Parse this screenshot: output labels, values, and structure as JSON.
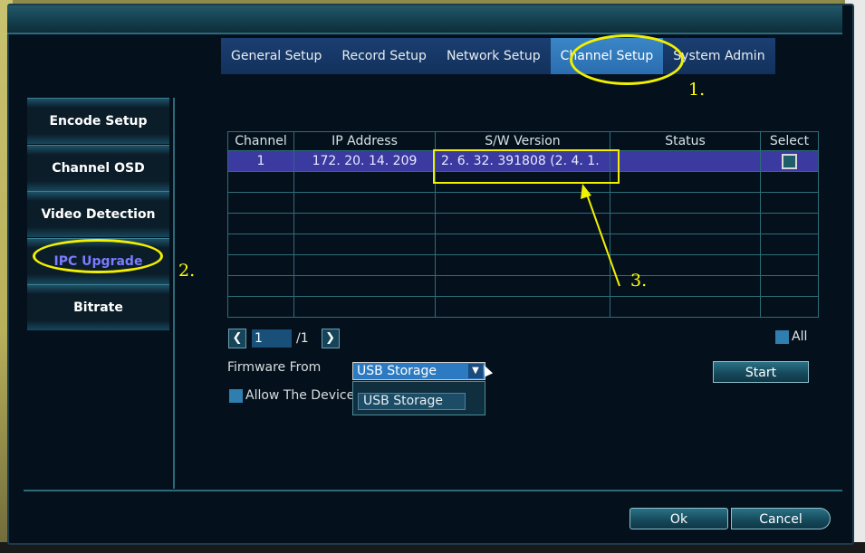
{
  "tabs": [
    {
      "label": "General Setup"
    },
    {
      "label": "Record Setup"
    },
    {
      "label": "Network Setup"
    },
    {
      "label": "Channel Setup",
      "active": true
    },
    {
      "label": "System Admin"
    }
  ],
  "sidebar": {
    "items": [
      {
        "label": "Encode Setup"
      },
      {
        "label": "Channel OSD"
      },
      {
        "label": "Video Detection"
      },
      {
        "label": "IPC Upgrade",
        "active": true
      },
      {
        "label": "Bitrate"
      }
    ]
  },
  "table": {
    "headers": [
      "Channel",
      "IP Address",
      "S/W Version",
      "Status",
      "Select"
    ],
    "rows": [
      {
        "channel": "1",
        "ip": "172. 20. 14. 209",
        "version": "2. 6. 32. 391808 (2. 4. 1.",
        "status": "",
        "selected": true
      }
    ],
    "empty_rows": 7
  },
  "pager": {
    "prev_icon": "chevron-left-icon",
    "next_icon": "chevron-right-icon",
    "page": "1",
    "total": "/1"
  },
  "all_label": "All",
  "firmware": {
    "label": "Firmware From",
    "selected": "USB Storage",
    "options": [
      "USB Storage"
    ]
  },
  "allow_label": "Allow The Device",
  "buttons": {
    "start": "Start",
    "ok": "Ok",
    "cancel": "Cancel"
  },
  "annotations": {
    "step1": "1.",
    "step2": "2.",
    "step3": "3."
  },
  "colors": {
    "accent_tab": "#2a6db0",
    "selected_row": "#3a3aa0",
    "annotation": "#ffff00"
  }
}
